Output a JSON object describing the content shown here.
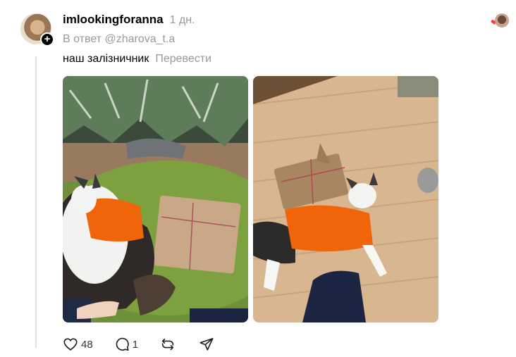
{
  "post": {
    "username": "imlookingforanna",
    "time": "1 дн.",
    "reply_prefix": "В ответ",
    "reply_mention": "@zharova_t.a",
    "text": "наш залізничник",
    "translate_label": "Перевести",
    "likes": "48",
    "replies": "1"
  },
  "icons": {
    "follow": "plus-icon",
    "like": "heart-icon",
    "reply": "comment-icon",
    "repost": "repost-icon",
    "share": "send-icon"
  },
  "colors": {
    "secondary_text": "#999999",
    "like_heart": "#ff3040",
    "thread_line": "#e0e0e0"
  }
}
